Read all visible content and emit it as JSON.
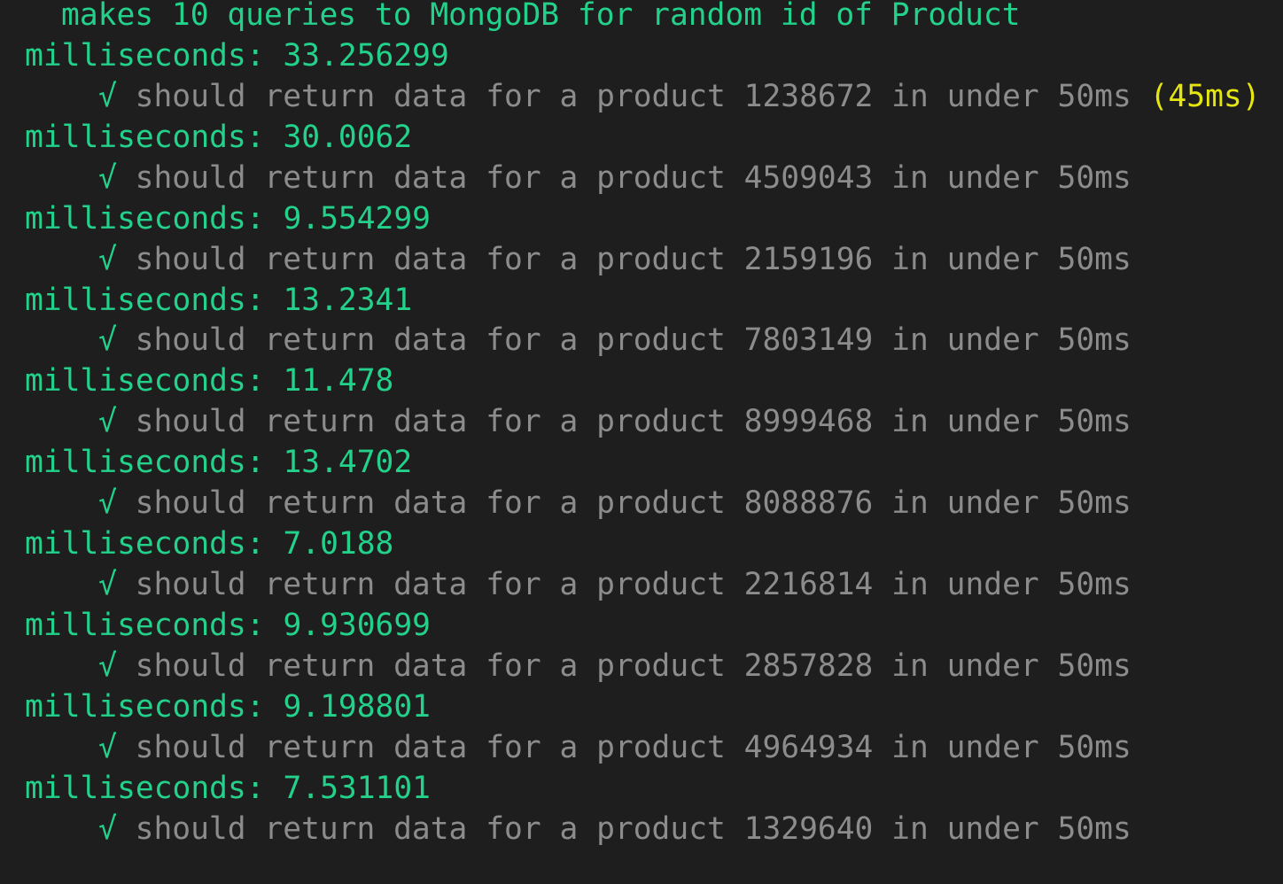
{
  "terminal": {
    "suite_title": "makes 10 queries to MongoDB for random id of Product",
    "check_glyph": "√",
    "colors": {
      "background": "#1e1e1e",
      "green": "#23d18b",
      "gray": "#8c8c8c",
      "yellow": "#e5e510"
    },
    "entries": [
      {
        "ms": "milliseconds: 33.256299",
        "test": "should return data for a product 1238672 in under 50ms",
        "duration": "(45ms)"
      },
      {
        "ms": "milliseconds: 30.0062",
        "test": "should return data for a product 4509043 in under 50ms",
        "duration": ""
      },
      {
        "ms": "milliseconds: 9.554299",
        "test": "should return data for a product 2159196 in under 50ms",
        "duration": ""
      },
      {
        "ms": "milliseconds: 13.2341",
        "test": "should return data for a product 7803149 in under 50ms",
        "duration": ""
      },
      {
        "ms": "milliseconds: 11.478",
        "test": "should return data for a product 8999468 in under 50ms",
        "duration": ""
      },
      {
        "ms": "milliseconds: 13.4702",
        "test": "should return data for a product 8088876 in under 50ms",
        "duration": ""
      },
      {
        "ms": "milliseconds: 7.0188",
        "test": "should return data for a product 2216814 in under 50ms",
        "duration": ""
      },
      {
        "ms": "milliseconds: 9.930699",
        "test": "should return data for a product 2857828 in under 50ms",
        "duration": ""
      },
      {
        "ms": "milliseconds: 9.198801",
        "test": "should return data for a product 4964934 in under 50ms",
        "duration": ""
      },
      {
        "ms": "milliseconds: 7.531101",
        "test": "should return data for a product 1329640 in under 50ms",
        "duration": ""
      }
    ]
  }
}
